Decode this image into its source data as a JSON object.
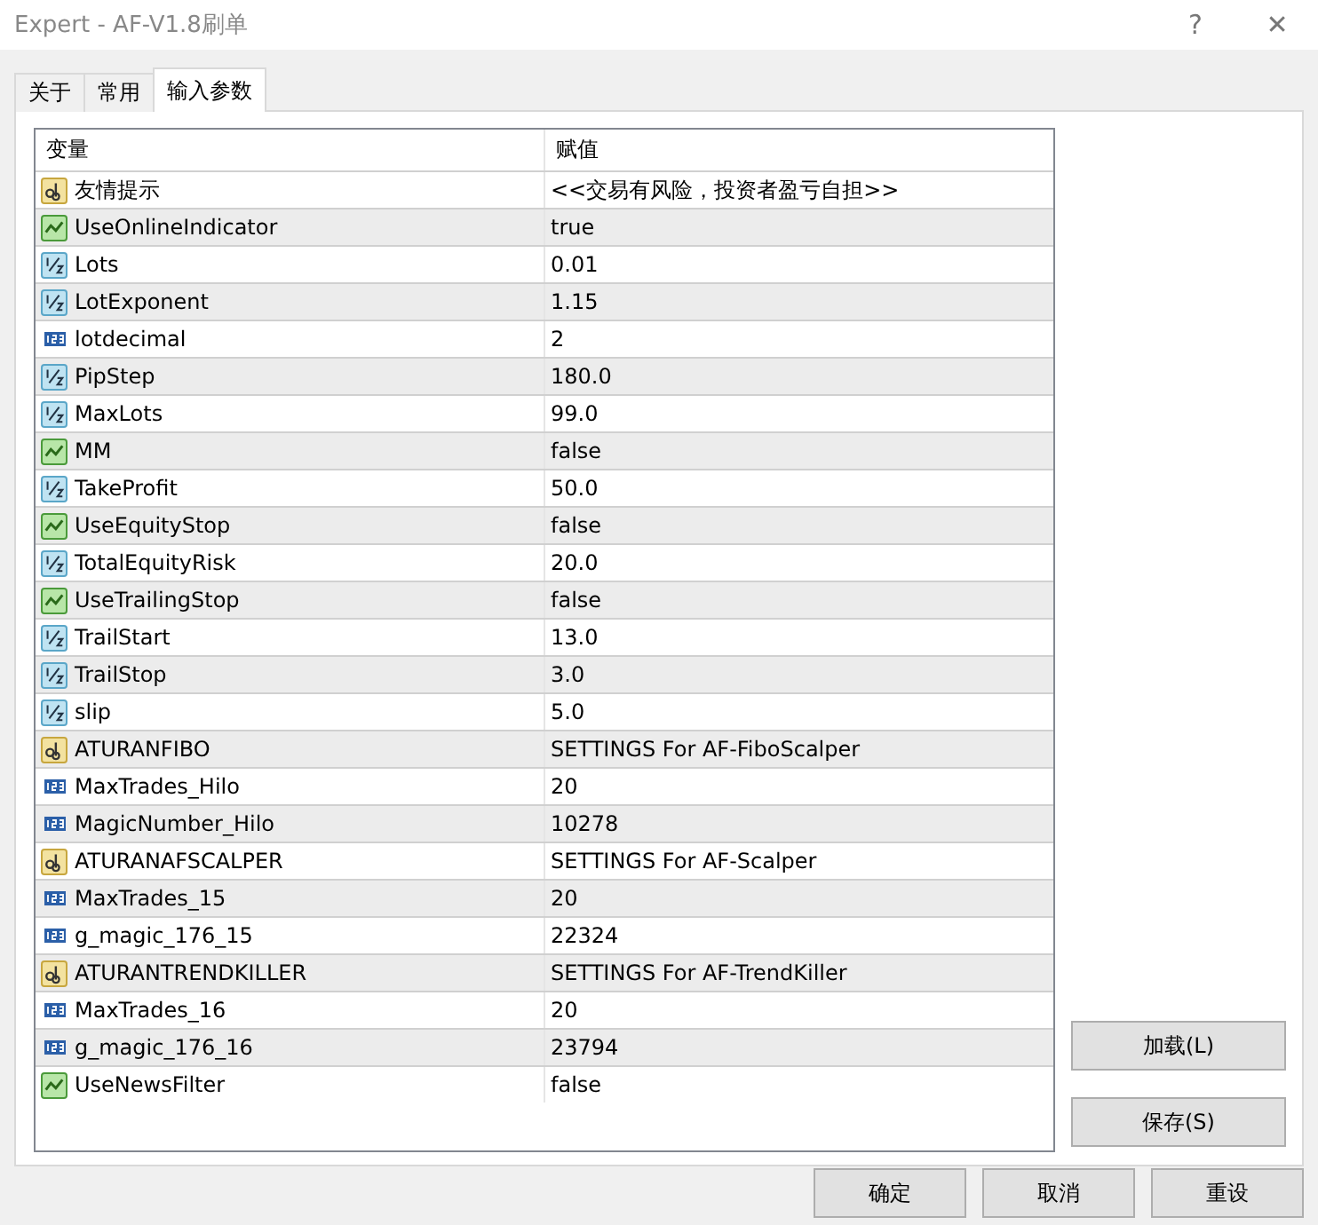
{
  "window": {
    "title": "Expert - AF-V1.8刷单",
    "help": "?",
    "close": "✕"
  },
  "tabs": [
    {
      "label": "关于",
      "selected": false
    },
    {
      "label": "常用",
      "selected": false
    },
    {
      "label": "输入参数",
      "selected": true
    }
  ],
  "table": {
    "columns": [
      "变量",
      "赋值"
    ],
    "rows": [
      {
        "kind": "string",
        "name": "友情提示",
        "value": "<<交易有风险，投资者盈亏自担>>"
      },
      {
        "kind": "bool",
        "name": "UseOnlineIndicator",
        "value": "true"
      },
      {
        "kind": "double",
        "name": "Lots",
        "value": "0.01"
      },
      {
        "kind": "double",
        "name": "LotExponent",
        "value": "1.15"
      },
      {
        "kind": "int",
        "name": "lotdecimal",
        "value": "2"
      },
      {
        "kind": "double",
        "name": "PipStep",
        "value": "180.0"
      },
      {
        "kind": "double",
        "name": "MaxLots",
        "value": "99.0"
      },
      {
        "kind": "bool",
        "name": "MM",
        "value": "false"
      },
      {
        "kind": "double",
        "name": "TakeProfit",
        "value": "50.0"
      },
      {
        "kind": "bool",
        "name": "UseEquityStop",
        "value": "false"
      },
      {
        "kind": "double",
        "name": "TotalEquityRisk",
        "value": "20.0"
      },
      {
        "kind": "bool",
        "name": "UseTrailingStop",
        "value": "false"
      },
      {
        "kind": "double",
        "name": "TrailStart",
        "value": "13.0"
      },
      {
        "kind": "double",
        "name": "TrailStop",
        "value": "3.0"
      },
      {
        "kind": "double",
        "name": "slip",
        "value": "5.0"
      },
      {
        "kind": "string",
        "name": "ATURANFIBO",
        "value": "SETTINGS For AF-FiboScalper"
      },
      {
        "kind": "int",
        "name": "MaxTrades_Hilo",
        "value": "20"
      },
      {
        "kind": "int",
        "name": "MagicNumber_Hilo",
        "value": "10278"
      },
      {
        "kind": "string",
        "name": "ATURANAFSCALPER",
        "value": "SETTINGS For AF-Scalper"
      },
      {
        "kind": "int",
        "name": "MaxTrades_15",
        "value": "20"
      },
      {
        "kind": "int",
        "name": "g_magic_176_15",
        "value": "22324"
      },
      {
        "kind": "string",
        "name": "ATURANTRENDKILLER",
        "value": "SETTINGS For AF-TrendKiller"
      },
      {
        "kind": "int",
        "name": "MaxTrades_16",
        "value": "20"
      },
      {
        "kind": "int",
        "name": "g_magic_176_16",
        "value": "23794"
      },
      {
        "kind": "bool",
        "name": "UseNewsFilter",
        "value": "false"
      }
    ]
  },
  "side_buttons": [
    "加载(L)",
    "保存(S)"
  ],
  "buttons": [
    "确定",
    "取消",
    "重设"
  ]
}
